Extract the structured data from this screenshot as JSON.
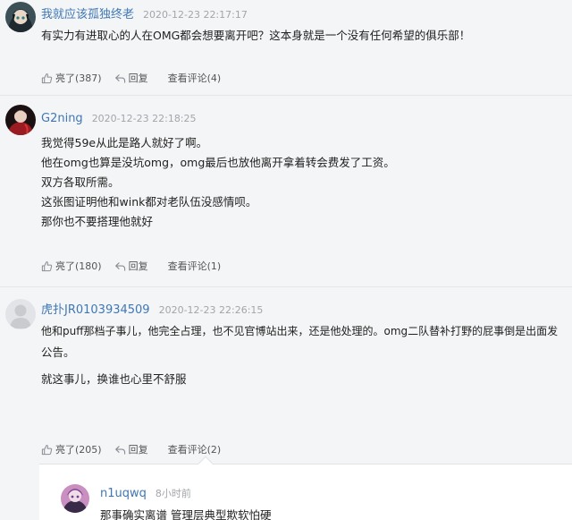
{
  "comments": [
    {
      "username": "我就应该孤独终老",
      "time": "2020-12-23 22:17:17",
      "lines": [
        "有实力有进取心的人在OMG都会想要离开吧？这本身就是一个没有任何希望的俱乐部！"
      ],
      "like_label": "亮了(387)",
      "reply_label": "回复",
      "view_label": "查看评论(4)"
    },
    {
      "username": "G2ning",
      "time": "2020-12-23 22:18:25",
      "lines": [
        "我觉得59e从此是路人就好了啊。",
        "他在omg也算是没坑omg，omg最后也放他离开拿着转会费发了工资。",
        "双方各取所需。",
        "这张图证明他和wink都对老队伍没感情呗。",
        "那你也不要搭理他就好"
      ],
      "like_label": "亮了(180)",
      "reply_label": "回复",
      "view_label": "查看评论(1)"
    },
    {
      "username": "虎扑JR0103934509",
      "time": "2020-12-23 22:26:15",
      "lines": [
        "他和puff那档子事儿，他完全占理，也不见官博站出来，还是他处理的。omg二队替补打野的屁事倒是出面发",
        "公告。",
        "就这事儿，换谁也心里不舒服"
      ],
      "like_label": "亮了(205)",
      "reply_label": "回复",
      "view_label": "查看评论(2)"
    }
  ],
  "reply": {
    "username": "n1uqwq",
    "time": "8小时前",
    "text": "那事确实离谱 管理层典型欺软怕硬"
  },
  "colors": {
    "username": "#3f77b4",
    "time": "#a3a5aa",
    "background": "#f4f5f7"
  }
}
